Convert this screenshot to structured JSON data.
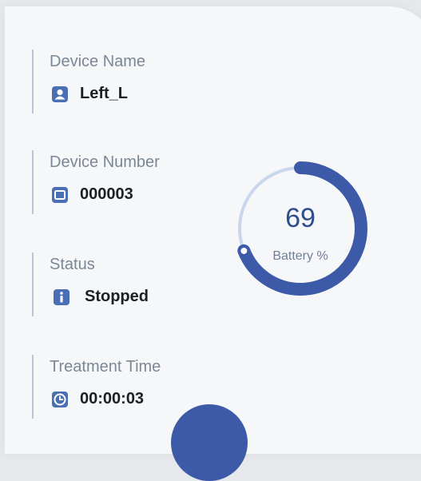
{
  "device_name": {
    "label": "Device Name",
    "value": "Left_L",
    "icon": "user-icon"
  },
  "device_number": {
    "label": "Device Number",
    "value": "000003",
    "icon": "device-icon"
  },
  "status": {
    "label": "Status",
    "value": "Stopped",
    "icon": "info-icon"
  },
  "treatment_time": {
    "label": "Treatment Time",
    "value": "00:00:03",
    "icon": "clock-icon"
  },
  "battery": {
    "value": 69,
    "display": "69",
    "caption": "Battery %"
  },
  "colors": {
    "accent": "#3d5aa8",
    "track": "#c9d6ee",
    "icon": "#4a6fb5"
  }
}
